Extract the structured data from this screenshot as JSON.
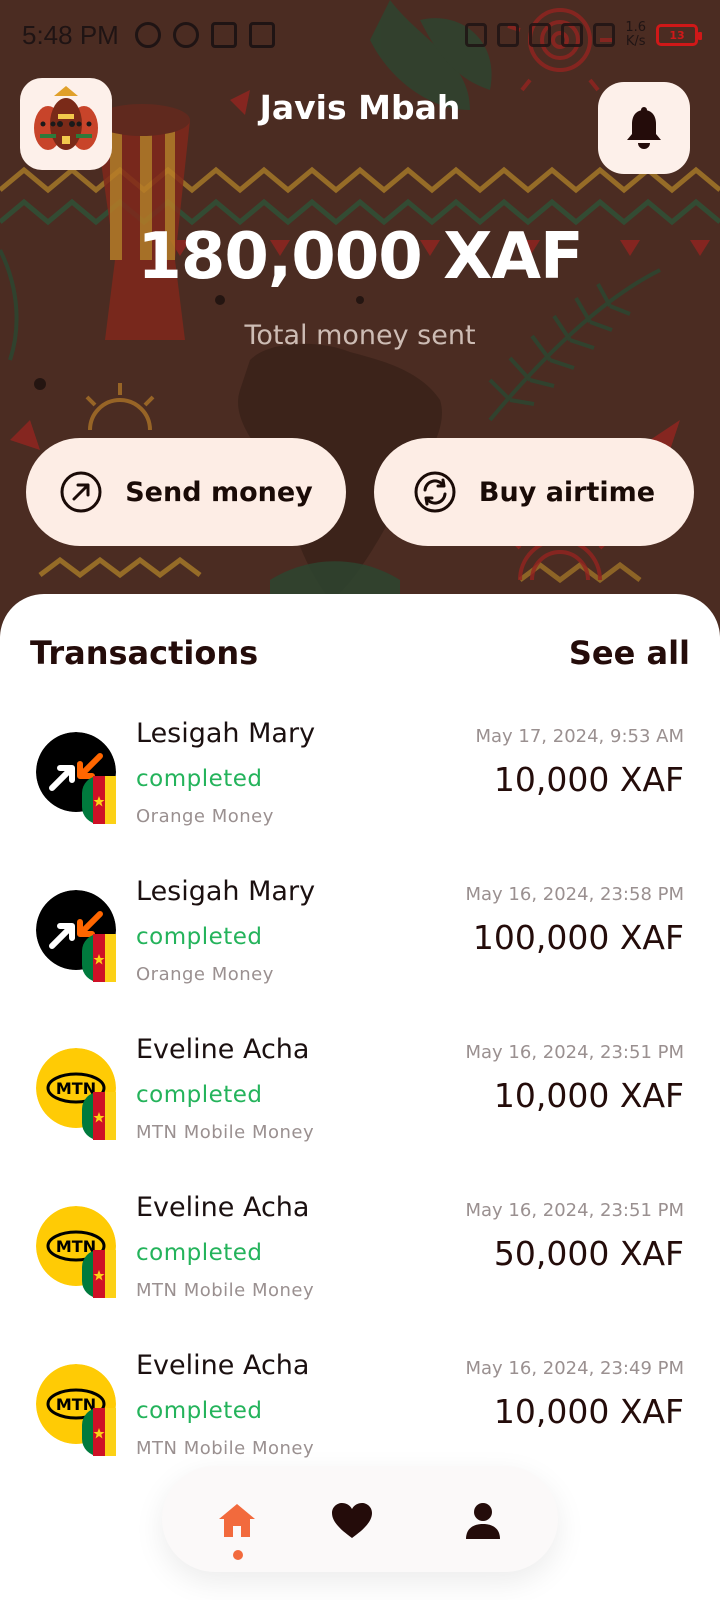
{
  "status_bar": {
    "time": "5:48 PM",
    "speed_value": "1.6",
    "speed_unit": "K/s",
    "battery": "13"
  },
  "header": {
    "user_name": "Javis Mbah",
    "avatar_icon": "tribal-masks-icon",
    "notification_icon": "bell-icon"
  },
  "summary": {
    "amount": "180,000 XAF",
    "label": "Total money sent"
  },
  "actions": {
    "send_label": "Send money",
    "send_icon": "arrow-up-right-circle-icon",
    "airtime_label": "Buy airtime",
    "airtime_icon": "refresh-circle-icon"
  },
  "transactions": {
    "title": "Transactions",
    "see_all": "See all",
    "items": [
      {
        "name": "Lesigah Mary",
        "status": "completed",
        "provider": "Orange Money",
        "date": "May 17, 2024, 9:53 AM",
        "amount": "10,000 XAF",
        "logo": "orange-money-logo"
      },
      {
        "name": "Lesigah Mary",
        "status": "completed",
        "provider": "Orange Money",
        "date": "May 16, 2024, 23:58 PM",
        "amount": "100,000 XAF",
        "logo": "orange-money-logo"
      },
      {
        "name": "Eveline Acha",
        "status": "completed",
        "provider": "MTN Mobile Money",
        "date": "May 16, 2024, 23:51 PM",
        "amount": "10,000 XAF",
        "logo": "mtn-logo"
      },
      {
        "name": "Eveline Acha",
        "status": "completed",
        "provider": "MTN Mobile Money",
        "date": "May 16, 2024, 23:51 PM",
        "amount": "50,000 XAF",
        "logo": "mtn-logo"
      },
      {
        "name": "Eveline Acha",
        "status": "completed",
        "provider": "MTN Mobile Money",
        "date": "May 16, 2024, 23:49 PM",
        "amount": "10,000 XAF",
        "logo": "mtn-logo"
      }
    ]
  },
  "colors": {
    "accent": "#f26a3d",
    "completed": "#24b35b",
    "button_bg": "#fdede5",
    "dark_text": "#240c0a"
  },
  "nav": {
    "items": [
      "home-icon",
      "heart-icon",
      "person-icon"
    ],
    "active": "home-icon"
  }
}
